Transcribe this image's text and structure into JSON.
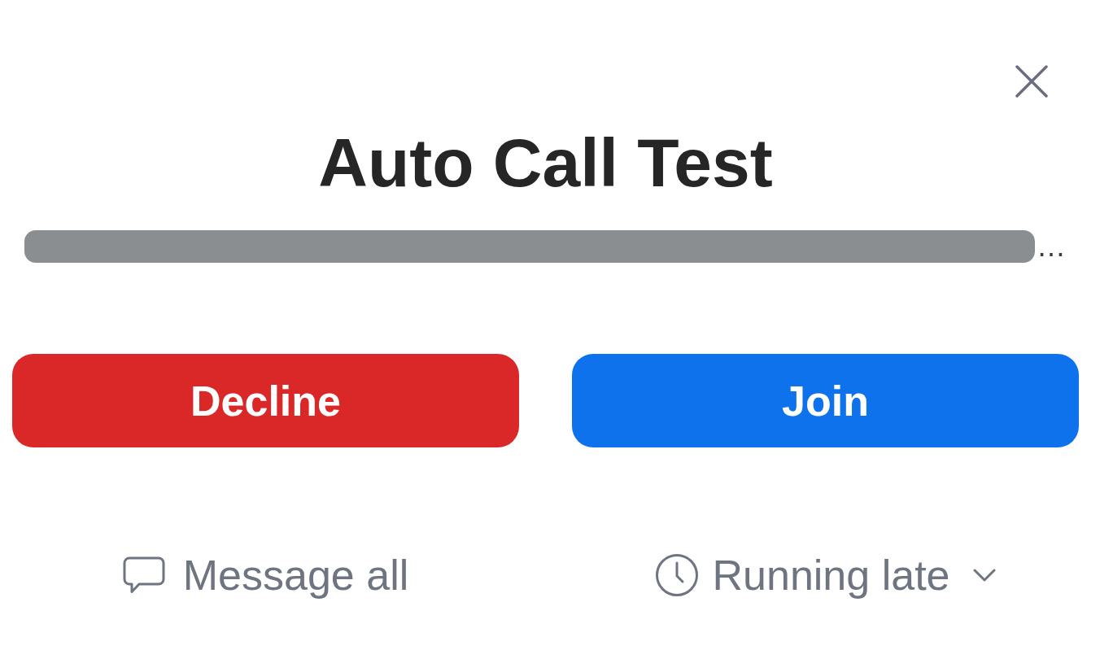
{
  "title": "Auto Call Test",
  "subtitle": {
    "redacted": true,
    "visible_text": "…"
  },
  "buttons": [
    {
      "label": "Decline",
      "kind": "decline"
    },
    {
      "label": "Join",
      "kind": "join"
    }
  ],
  "actions": [
    {
      "label": "Message all",
      "kind": "message",
      "dropdown": false
    },
    {
      "label": "Running late",
      "kind": "status",
      "dropdown": true
    }
  ]
}
